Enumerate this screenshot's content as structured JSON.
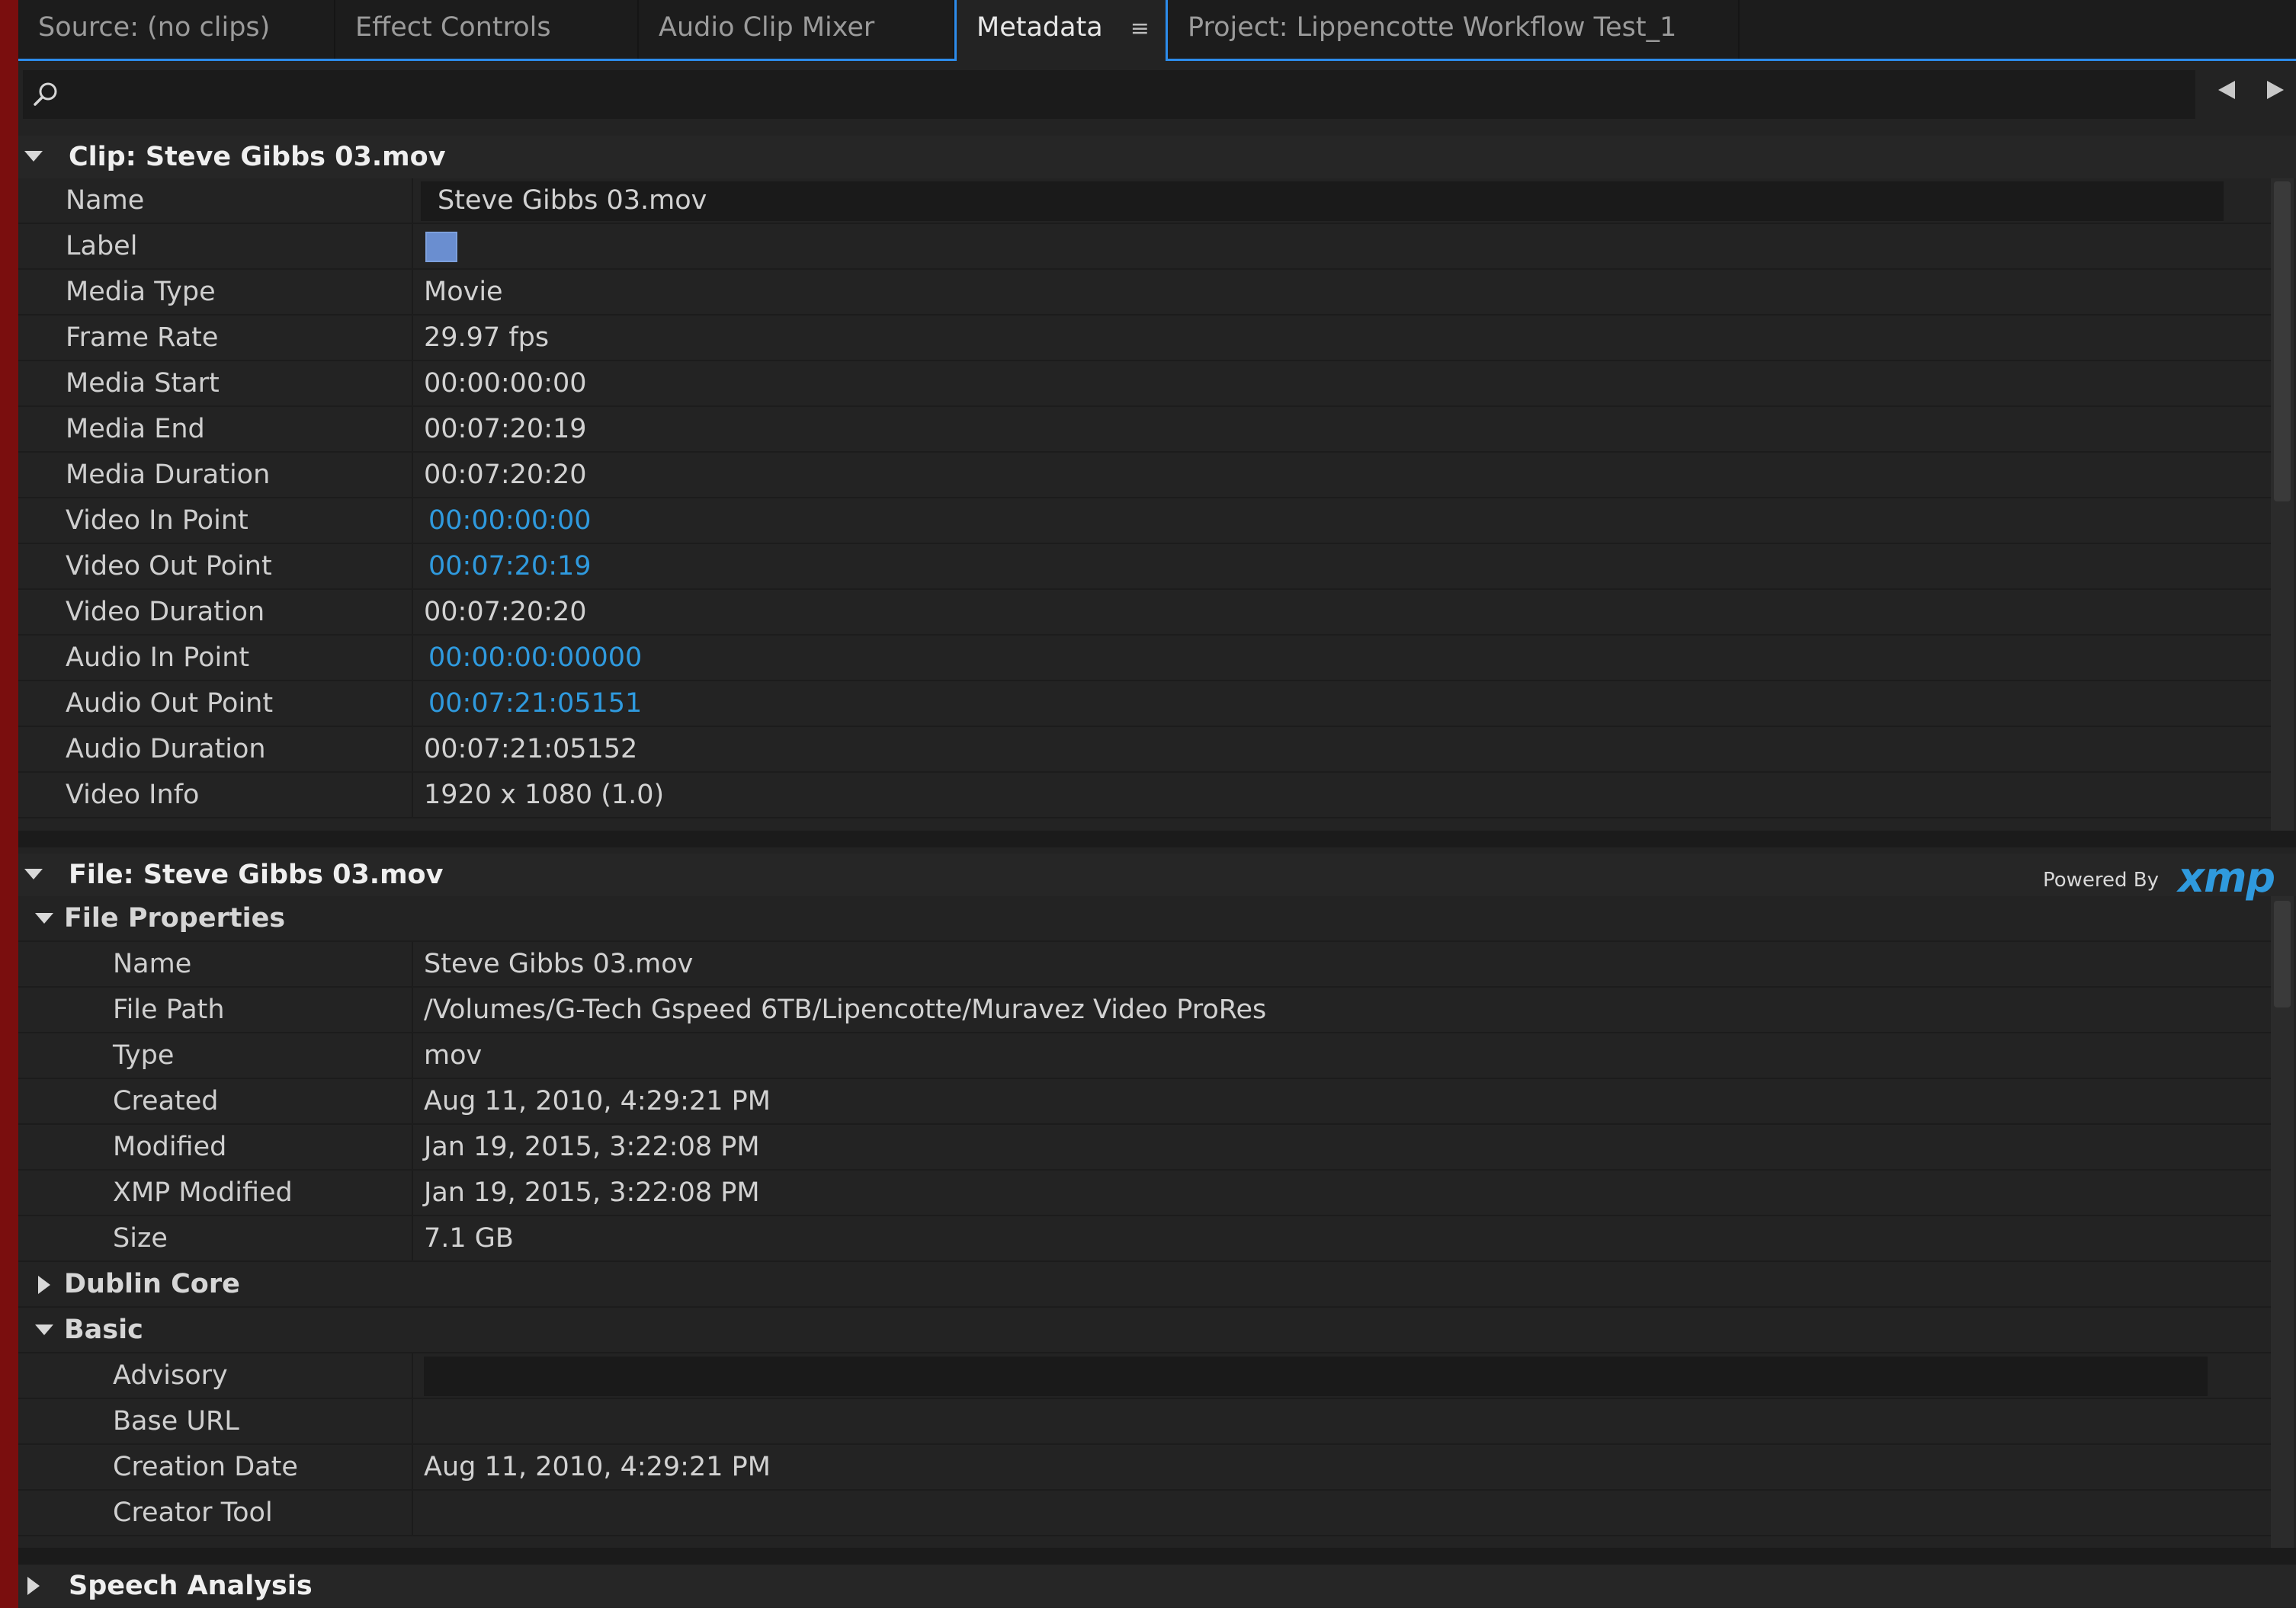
{
  "tabs": [
    {
      "label": "Source: (no clips)"
    },
    {
      "label": "Effect Controls"
    },
    {
      "label": "Audio Clip Mixer"
    },
    {
      "label": "Metadata"
    },
    {
      "label": "Project: Lippencotte Workflow Test_1"
    }
  ],
  "tab_menu_glyph": "≡",
  "clip_section": {
    "title": "Clip: Steve Gibbs 03.mov",
    "rows": [
      {
        "key": "Name",
        "value": "Steve Gibbs 03.mov"
      },
      {
        "key": "Label",
        "value": "",
        "label_color": "#6a8ed0"
      },
      {
        "key": "Media Type",
        "value": "Movie"
      },
      {
        "key": "Frame Rate",
        "value": "29.97 fps"
      },
      {
        "key": "Media Start",
        "value": "00:00:00:00"
      },
      {
        "key": "Media End",
        "value": "00:07:20:19"
      },
      {
        "key": "Media Duration",
        "value": "00:07:20:20"
      },
      {
        "key": "Video In Point",
        "value": "00:00:00:00"
      },
      {
        "key": "Video Out Point",
        "value": "00:07:20:19"
      },
      {
        "key": "Video Duration",
        "value": "00:07:20:20"
      },
      {
        "key": "Audio In Point",
        "value": "00:00:00:00000"
      },
      {
        "key": "Audio Out Point",
        "value": "00:07:21:05151"
      },
      {
        "key": "Audio Duration",
        "value": "00:07:21:05152"
      },
      {
        "key": "Video Info",
        "value": "1920 x 1080 (1.0)"
      }
    ]
  },
  "file_section": {
    "title": "File: Steve Gibbs 03.mov",
    "powered_by": "Powered By",
    "xmp_logo": "xmp",
    "file_properties": {
      "title": "File Properties",
      "rows": [
        {
          "key": "Name",
          "value": "Steve Gibbs 03.mov"
        },
        {
          "key": "File Path",
          "value": "/Volumes/G-Tech Gspeed 6TB/Lipencotte/Muravez Video ProRes"
        },
        {
          "key": "Type",
          "value": "mov"
        },
        {
          "key": "Created",
          "value": "Aug 11, 2010, 4:29:21 PM"
        },
        {
          "key": "Modified",
          "value": "Jan 19, 2015, 3:22:08 PM"
        },
        {
          "key": "XMP Modified",
          "value": "Jan 19, 2015, 3:22:08 PM"
        },
        {
          "key": "Size",
          "value": "7.1 GB"
        }
      ]
    },
    "dublin_core": {
      "title": "Dublin Core"
    },
    "basic": {
      "title": "Basic",
      "rows": [
        {
          "key": "Advisory",
          "value": ""
        },
        {
          "key": "Base URL",
          "value": ""
        },
        {
          "key": "Creation Date",
          "value": "Aug 11, 2010, 4:29:21 PM"
        },
        {
          "key": "Creator Tool",
          "value": ""
        }
      ]
    }
  },
  "speech_section": {
    "title": "Speech Analysis"
  },
  "colors": {
    "accent": "#2d8ceb",
    "link": "#2f9ade",
    "panel": "#232323"
  }
}
